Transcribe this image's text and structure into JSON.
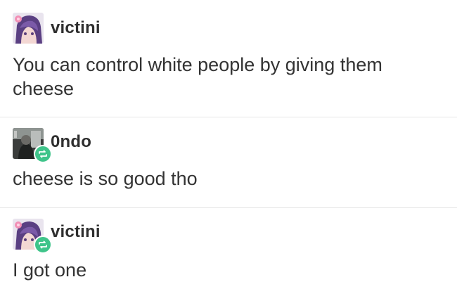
{
  "posts": [
    {
      "username": "victini",
      "text": "You can control white people by giving them cheese",
      "avatar_icon": "anime-girl-avatar",
      "reblogged": false
    },
    {
      "username": "0ndo",
      "text": "cheese is so good tho",
      "avatar_icon": "dark-photo-avatar",
      "reblogged": true
    },
    {
      "username": "victini",
      "text": "I got one",
      "avatar_icon": "anime-girl-avatar",
      "reblogged": true
    }
  ],
  "colors": {
    "reblog_badge": "#3fc48a",
    "divider": "#e6e6e6",
    "text": "#333333"
  }
}
